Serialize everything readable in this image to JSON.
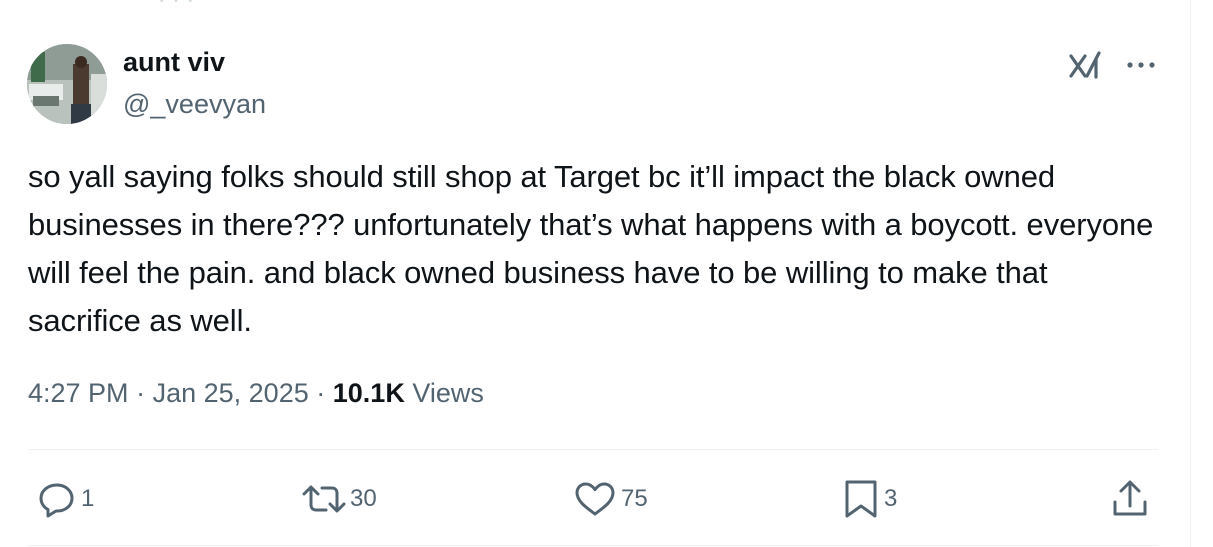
{
  "author": {
    "display_name": "aunt viv",
    "handle": "@_veevyan"
  },
  "tweet": {
    "text": "so yall saying folks should still shop at Target bc it’ll impact the black owned businesses in there??? unfortunately that’s what happens with a boycott. everyone will feel the pain. and black owned business have to be willing to make that sacrifice as well."
  },
  "meta": {
    "time": "4:27 PM",
    "separator": "·",
    "date": "Jan 25, 2025",
    "views_count": "10.1K",
    "views_label": "Views"
  },
  "actions": {
    "reply_count": "1",
    "repost_count": "30",
    "like_count": "75",
    "bookmark_count": "3"
  },
  "icons": {
    "header": [
      "grok-icon",
      "more-options-icon"
    ],
    "actions": [
      "reply-icon",
      "repost-icon",
      "like-icon",
      "bookmark-icon",
      "share-icon"
    ]
  },
  "colors": {
    "text_primary": "#0f1419",
    "text_secondary": "#536471",
    "divider": "#eff3f4"
  }
}
